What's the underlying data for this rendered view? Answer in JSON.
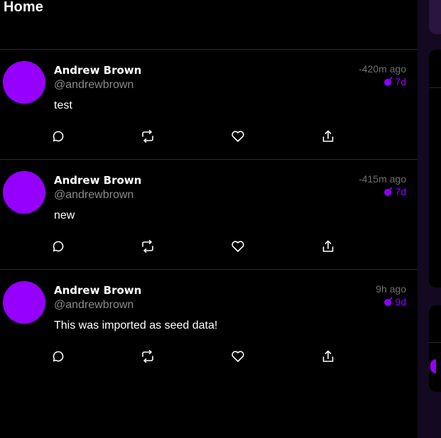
{
  "header": {
    "title": "Home"
  },
  "posts": [
    {
      "display_name": "Andrew Brown",
      "handle": "@andrewbrown",
      "time": "-420m ago",
      "expires": "7d",
      "message": "test"
    },
    {
      "display_name": "Andrew Brown",
      "handle": "@andrewbrown",
      "time": "-415m ago",
      "expires": "7d",
      "message": "new"
    },
    {
      "display_name": "Andrew Brown",
      "handle": "@andrewbrown",
      "time": "9h ago",
      "expires": "9d",
      "message": "This was imported as seed data!"
    }
  ],
  "icons": {
    "reply": "reply-icon",
    "repost": "repost-icon",
    "like": "heart-icon",
    "share": "share-icon",
    "expiry": "bomb-icon"
  },
  "colors": {
    "background": "#000000",
    "accent": "#9500ff",
    "sidebar": "#130921",
    "muted_text": "#8a8a8a"
  }
}
